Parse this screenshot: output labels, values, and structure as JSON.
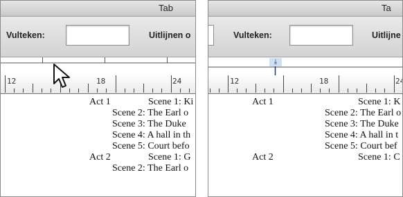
{
  "left_panel": {
    "title_fragment": "Tab",
    "fill_label": "Vulteken:",
    "fill_value": "",
    "align_label": "Uitlijnen o",
    "ruler_numbers": [
      "12",
      "18",
      "24"
    ],
    "content_lines": [
      {
        "act": "Act 1",
        "text": "Scene 1: Ki"
      },
      {
        "act": "",
        "text": "Scene 2: The Earl o"
      },
      {
        "act": "",
        "text": "Scene 3: The Duke"
      },
      {
        "act": "",
        "text": "Scene 4: A hall in th"
      },
      {
        "act": "",
        "text": "Scene 5: Court befo"
      },
      {
        "act": "Act 2",
        "text": "Scene 1: G"
      },
      {
        "act": "",
        "text": "Scene 2: The Earl o"
      }
    ]
  },
  "right_panel": {
    "title_fragment": "Ta",
    "fill_label": "Vulteken:",
    "fill_value": "",
    "align_label": "Uitlijne",
    "tab_marker": "⤓",
    "ruler_numbers": [
      "12",
      "18",
      "24"
    ],
    "content_lines": [
      {
        "act": "Act 1",
        "text": "Scene 1: K"
      },
      {
        "act": "",
        "text": "Scene 2: The Earl o"
      },
      {
        "act": "",
        "text": "Scene 3: The Duke"
      },
      {
        "act": "",
        "text": "Scene 4: A hall in t"
      },
      {
        "act": "",
        "text": "Scene 5: Court bef"
      },
      {
        "act": "Act 2",
        "text": "Scene 1: C"
      }
    ]
  },
  "colors": {
    "tab_marker_highlight": "#cfe0f3",
    "panel_chrome": "#d8d8d8"
  },
  "icons": {
    "pointer": "arrow-pointer-icon",
    "tab_stop": "tab-stop-icon"
  }
}
